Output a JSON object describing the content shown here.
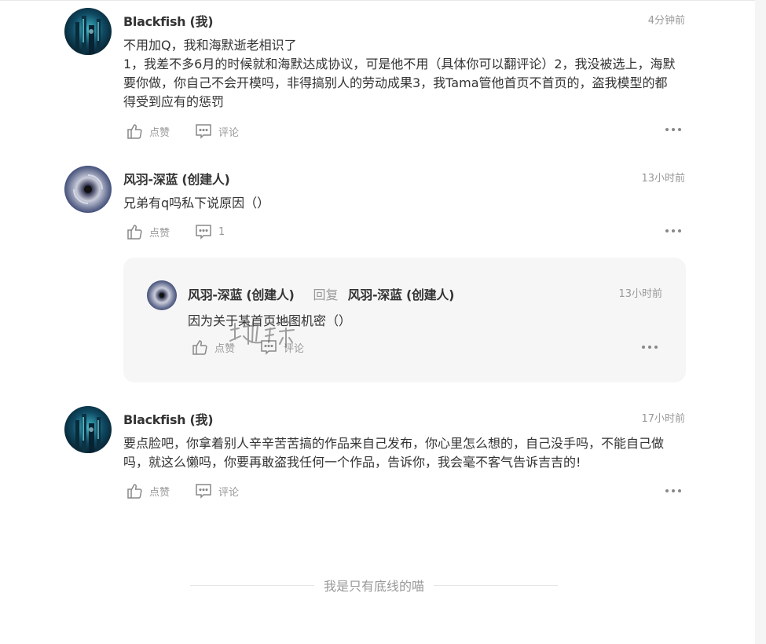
{
  "comments": [
    {
      "author": "Blackfish (我)",
      "time": "4分钟前",
      "lines": [
        "不用加Q，我和海默逝老相识了",
        "1，我差不多6月的时候就和海默达成协议，可是他不用（具体你可以翻评论）2，我没被选上，海默要你做，你自己不会开模吗，非得搞别人的劳动成果3，我Tama管他首页不首页的，盗我模型的都得受到应有的惩罚"
      ],
      "like_label": "点赞",
      "comment_label": "评论"
    },
    {
      "author": "风羽-深蓝 (创建人)",
      "time": "13小时前",
      "lines": [
        "兄弟有q吗私下说原因（）"
      ],
      "like_label": "点赞",
      "comment_label": "1"
    },
    {
      "author": "Blackfish (我)",
      "time": "17小时前",
      "lines": [
        "要点脸吧，你拿着别人辛辛苦苦搞的作品来自己发布，你心里怎么想的，自己没手吗，不能自己做吗，就这么懒吗，你要再敢盗我任何一个作品，告诉你，我会毫不客气告诉吉吉的!"
      ],
      "like_label": "点赞",
      "comment_label": "评论"
    }
  ],
  "reply": {
    "author": "风羽-深蓝 (创建人)",
    "reply_word": "回复",
    "target": "风羽-深蓝 (创建人)",
    "time": "13小时前",
    "text": "因为关于某首页地图机密（）",
    "like_label": "点赞",
    "comment_label": "评论"
  },
  "footer": {
    "text": "我是只有底线的喵"
  },
  "watermark": "地铁"
}
